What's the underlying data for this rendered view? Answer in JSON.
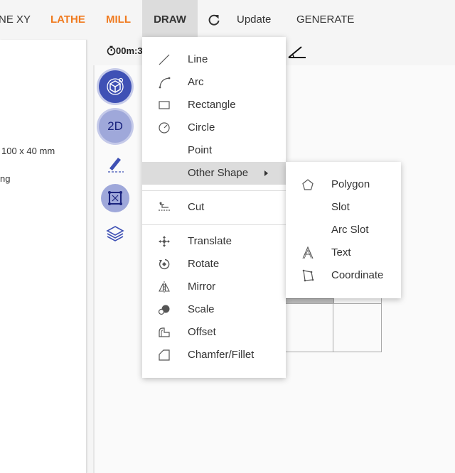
{
  "topbar": {
    "plane_tab": "NE XY",
    "lathe_tab": "LATHE",
    "mill_tab": "MILL",
    "draw_tab": "DRAW",
    "update_label": "Update",
    "generate_label": "GENERATE"
  },
  "left_panel": {
    "dimensions": "100 x 40 mm",
    "partial_text": "ng"
  },
  "workspace": {
    "timer": "00m:3",
    "tool_2d_label": "2D"
  },
  "draw_menu": {
    "items": [
      {
        "label": "Line",
        "icon": "line-icon"
      },
      {
        "label": "Arc",
        "icon": "arc-icon"
      },
      {
        "label": "Rectangle",
        "icon": "rectangle-icon"
      },
      {
        "label": "Circle",
        "icon": "circle-icon"
      },
      {
        "label": "Point",
        "icon": ""
      },
      {
        "label": "Other Shape",
        "icon": ""
      },
      {
        "label": "Cut",
        "icon": "cut-icon"
      },
      {
        "label": "Translate",
        "icon": "translate-icon"
      },
      {
        "label": "Rotate",
        "icon": "rotate-icon"
      },
      {
        "label": "Mirror",
        "icon": "mirror-icon"
      },
      {
        "label": "Scale",
        "icon": "scale-icon"
      },
      {
        "label": "Offset",
        "icon": "offset-icon"
      },
      {
        "label": "Chamfer/Fillet",
        "icon": "chamfer-fillet-icon"
      }
    ]
  },
  "other_shape_menu": {
    "items": [
      {
        "label": "Polygon",
        "icon": "polygon-icon"
      },
      {
        "label": "Slot",
        "icon": ""
      },
      {
        "label": "Arc Slot",
        "icon": ""
      },
      {
        "label": "Text",
        "icon": "text-icon"
      },
      {
        "label": "Coordinate",
        "icon": "coordinate-icon"
      }
    ]
  },
  "colors": {
    "accent_orange": "#f07a1e",
    "tool_dark": "#3f51b5",
    "tool_light": "#9fa8da"
  }
}
